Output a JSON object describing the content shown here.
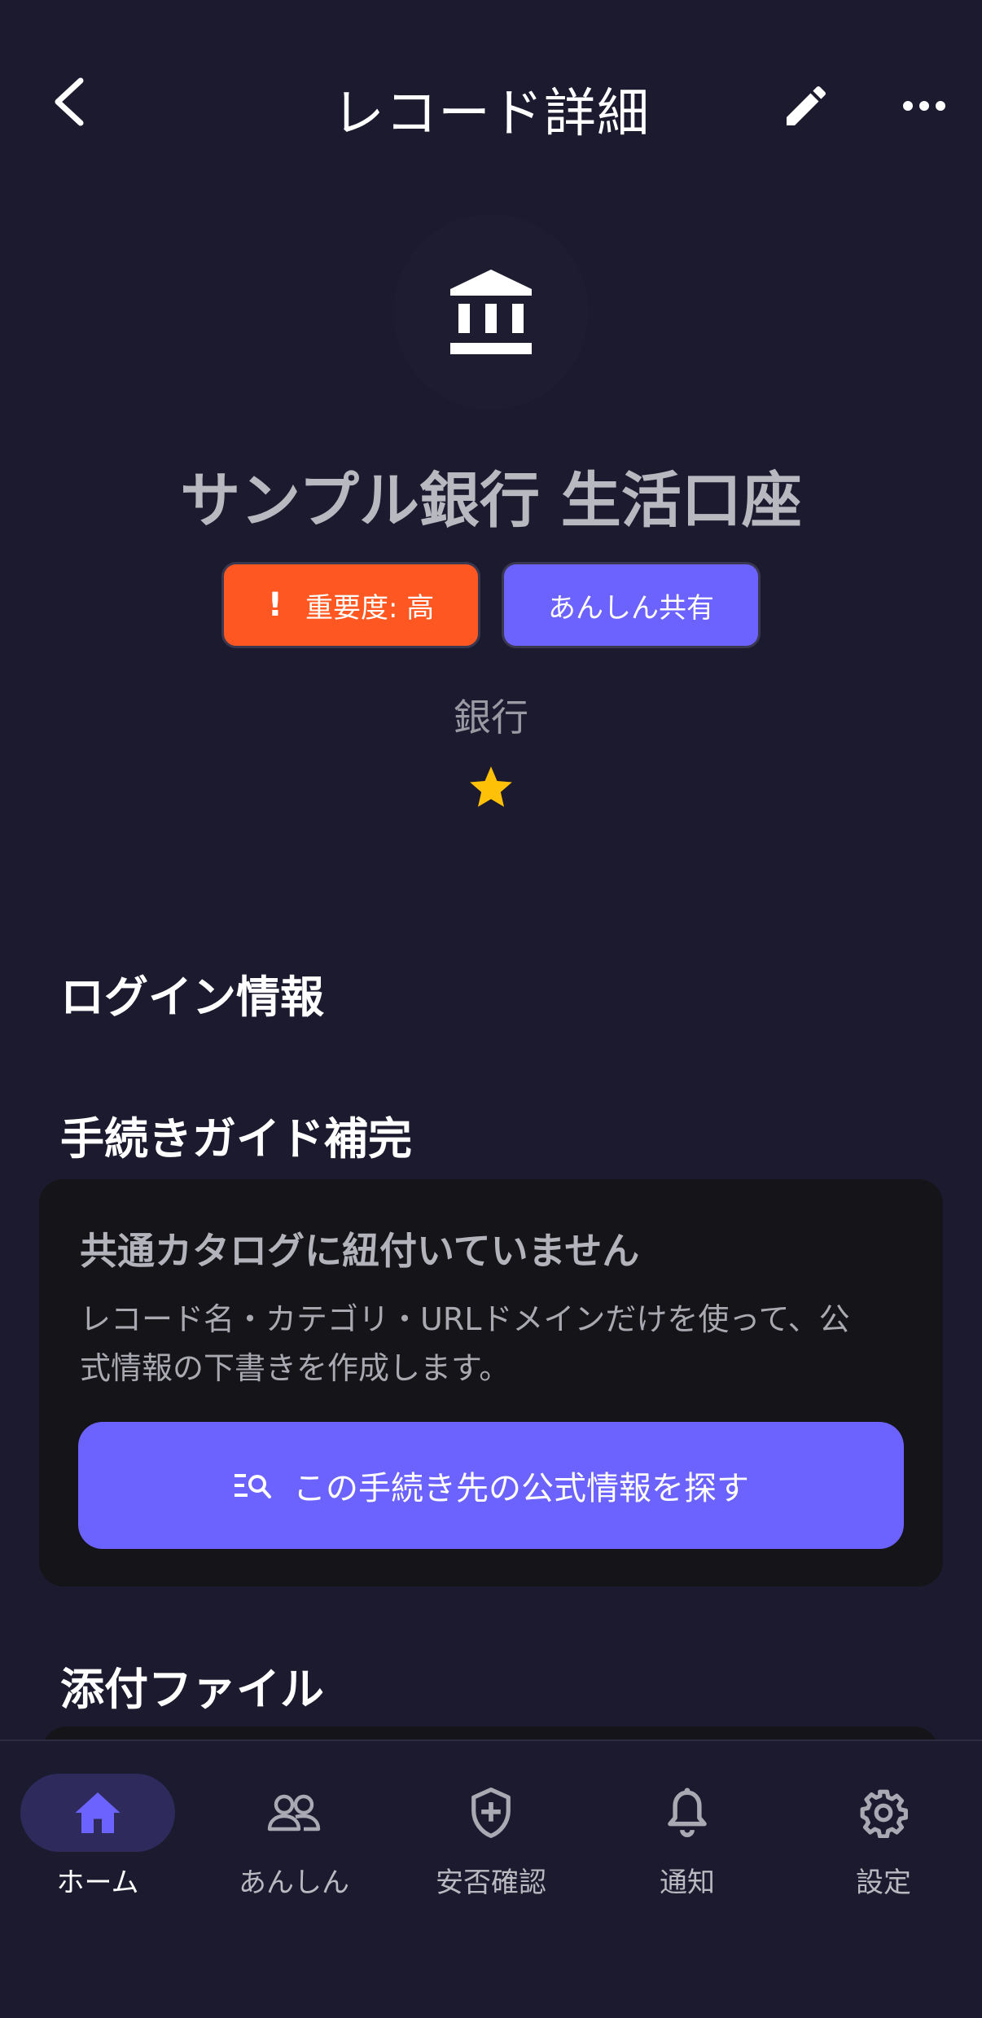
{
  "header": {
    "title": "レコード詳細",
    "back_icon": "chevron-left-icon",
    "edit_icon": "pencil-icon",
    "more_icon": "more-horizontal-icon"
  },
  "record": {
    "icon": "bank-icon",
    "title": "サンプル銀行 生活口座",
    "importance_badge": "重要度: 高",
    "importance_mark": "!",
    "share_badge": "あんしん共有",
    "category": "銀行",
    "favorite": true
  },
  "sections": {
    "login": "ログイン情報",
    "guide": "手続きガイド補完",
    "attachments": "添付ファイル"
  },
  "guide_card": {
    "title": "共通カタログに紐付いていません",
    "description": "レコード名・カテゴリ・URLドメインだけを使って、公式情報の下書きを作成します。",
    "button_label": "この手続き先の公式情報を探す",
    "button_icon": "manage-search-icon"
  },
  "bottom_nav": [
    {
      "label": "ホーム",
      "icon": "home-icon",
      "active": true
    },
    {
      "label": "あんしん",
      "icon": "people-icon",
      "active": false
    },
    {
      "label": "安否確認",
      "icon": "shield-plus-icon",
      "active": false
    },
    {
      "label": "通知",
      "icon": "bell-icon",
      "active": false
    },
    {
      "label": "設定",
      "icon": "gear-icon",
      "active": false
    }
  ],
  "colors": {
    "background": "#1b1a2e",
    "accent": "#6c63ff",
    "importance": "#ff5722",
    "star": "#ffc107"
  }
}
